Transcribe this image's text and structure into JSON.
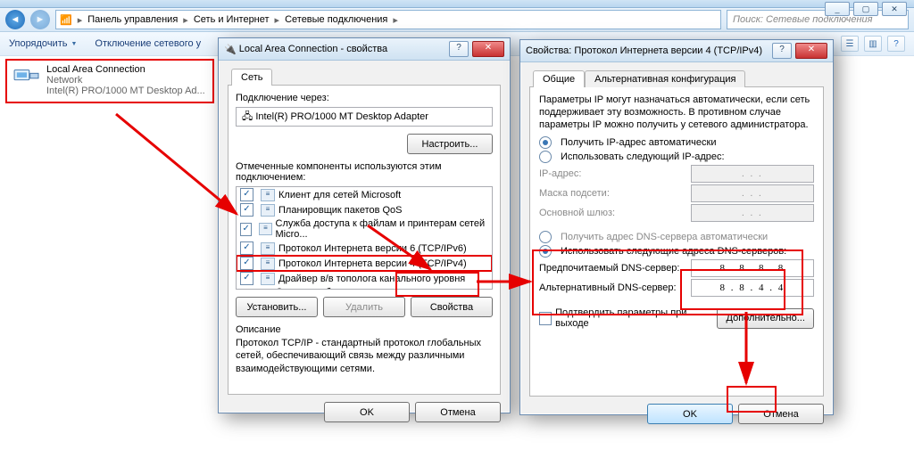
{
  "explorer": {
    "breadcrumb": [
      "Панель управления",
      "Сеть и Интернет",
      "Сетевые подключения"
    ],
    "search_placeholder": "Поиск: Сетевые подключения",
    "organize": "Упорядочить",
    "disable": "Отключение сетевого у"
  },
  "connection": {
    "name": "Local Area Connection",
    "status": "Network",
    "adapter": "Intel(R) PRO/1000 MT Desktop Ad..."
  },
  "dlg1": {
    "title": "Local Area Connection - свойства",
    "tab": "Сеть",
    "connect_via": "Подключение через:",
    "adapter": "Intel(R) PRO/1000 MT Desktop Adapter",
    "configure": "Настроить...",
    "components_label": "Отмеченные компоненты используются этим подключением:",
    "components": [
      {
        "checked": true,
        "label": "Клиент для сетей Microsoft"
      },
      {
        "checked": true,
        "label": "Планировщик пакетов QoS"
      },
      {
        "checked": true,
        "label": "Служба доступа к файлам и принтерам сетей Micro..."
      },
      {
        "checked": true,
        "label": "Протокол Интернета версии 6 (TCP/IPv6)"
      },
      {
        "checked": true,
        "label": "Протокол Интернета версии 4 (TCP/IPv4)",
        "hl": true
      },
      {
        "checked": true,
        "label": "Драйвер в/в тополога канального уровня"
      },
      {
        "checked": true,
        "label": "Ответчик обнаружения топологии канального уровня"
      }
    ],
    "install": "Установить...",
    "uninstall": "Удалить",
    "properties": "Свойства",
    "desc_head": "Описание",
    "desc": "Протокол TCP/IP - стандартный протокол глобальных сетей, обеспечивающий связь между различными взаимодействующими сетями.",
    "ok": "OK",
    "cancel": "Отмена"
  },
  "dlg2": {
    "title": "Свойства: Протокол Интернета версии 4 (TCP/IPv4)",
    "tab_general": "Общие",
    "tab_alt": "Альтернативная конфигурация",
    "hint": "Параметры IP могут назначаться автоматически, если сеть поддерживает эту возможность. В противном случае параметры IP можно получить у сетевого администратора.",
    "ip_auto": "Получить IP-адрес автоматически",
    "ip_manual": "Использовать следующий IP-адрес:",
    "ip_addr": "IP-адрес:",
    "mask": "Маска подсети:",
    "gateway": "Основной шлюз:",
    "dns_auto": "Получить адрес DNS-сервера автоматически",
    "dns_manual": "Использовать следующие адреса DNS-серверов:",
    "dns_pref": "Предпочитаемый DNS-сервер:",
    "dns_alt": "Альтернативный DNS-сервер:",
    "dns1": "8 . 8 . 8 . 8",
    "dns2": "8 . 8 . 4 . 4",
    "validate": "Подтвердить параметры при выходе",
    "advanced": "Дополнительно...",
    "ok": "OK",
    "cancel": "Отмена",
    "empty_ip": ".       .       ."
  }
}
